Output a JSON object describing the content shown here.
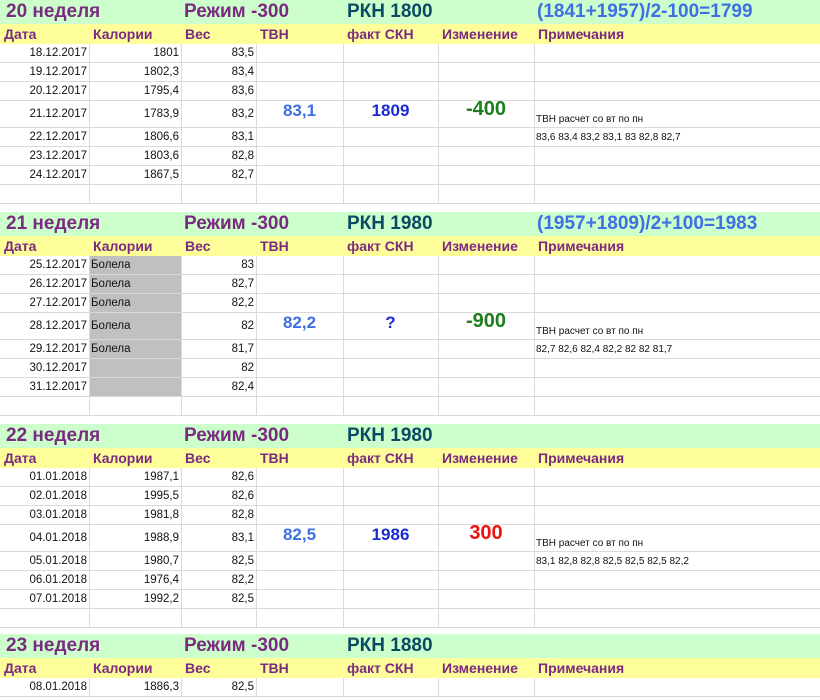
{
  "headers": {
    "date": "Дата",
    "calories": "Калории",
    "weight": "Вес",
    "tvn": "ТВН",
    "fact_skn": "факт СКН",
    "change": "Изменение",
    "notes": "Примечания"
  },
  "weeks": [
    {
      "week": "20  неделя",
      "mode": "Режим -300",
      "rkn": "РКН 1800",
      "formula": "(1841+1957)/2-100=1799",
      "rows": [
        {
          "date": "18.12.2017",
          "cal": "1801",
          "weight": "83,5"
        },
        {
          "date": "19.12.2017",
          "cal": "1802,3",
          "weight": "83,4"
        },
        {
          "date": "20.12.2017",
          "cal": "1795,4",
          "weight": "83,6"
        },
        {
          "date": "21.12.2017",
          "cal": "1783,9",
          "weight": "83,2",
          "tvn": "83,1",
          "fact": "1809",
          "change": "-400",
          "change_color": "green",
          "note": "ТВН расчет со вт по пн"
        },
        {
          "date": "22.12.2017",
          "cal": "1806,6",
          "weight": "83,1",
          "note": "83,6  83,4  83,2  83,1  83  82,8  82,7"
        },
        {
          "date": "23.12.2017",
          "cal": "1803,6",
          "weight": "82,8"
        },
        {
          "date": "24.12.2017",
          "cal": "1867,5",
          "weight": "82,7"
        }
      ]
    },
    {
      "week": "21  неделя",
      "mode": "Режим -300",
      "rkn": "РКН  1980",
      "formula": "(1957+1809)/2+100=1983",
      "rows": [
        {
          "date": "25.12.2017",
          "cal": "Болела",
          "weight": "83",
          "gray": true
        },
        {
          "date": "26.12.2017",
          "cal": "Болела",
          "weight": "82,7",
          "gray": true
        },
        {
          "date": "27.12.2017",
          "cal": "Болела",
          "weight": "82,2",
          "gray": true
        },
        {
          "date": "28.12.2017",
          "cal": "Болела",
          "weight": "82",
          "gray": true,
          "tvn": "82,2",
          "fact": "?",
          "change": "-900",
          "change_color": "green",
          "note": "ТВН расчет со вт по пн"
        },
        {
          "date": "29.12.2017",
          "cal": "Болела",
          "weight": "81,7",
          "gray": true,
          "note": "82,7  82,6  82,4  82,2  82  82  81,7"
        },
        {
          "date": "30.12.2017",
          "cal": "",
          "weight": "82",
          "gray": true
        },
        {
          "date": "31.12.2017",
          "cal": "",
          "weight": "82,4",
          "gray": true
        }
      ]
    },
    {
      "week": "22  неделя",
      "mode": "Режим -300",
      "rkn": "РКН  1980",
      "formula": "",
      "rows": [
        {
          "date": "01.01.2018",
          "cal": "1987,1",
          "weight": "82,6"
        },
        {
          "date": "02.01.2018",
          "cal": "1995,5",
          "weight": "82,6"
        },
        {
          "date": "03.01.2018",
          "cal": "1981,8",
          "weight": "82,8"
        },
        {
          "date": "04.01.2018",
          "cal": "1988,9",
          "weight": "83,1",
          "tvn": "82,5",
          "fact": "1986",
          "change": "300",
          "change_color": "red",
          "note": "ТВН расчет со вт по пн"
        },
        {
          "date": "05.01.2018",
          "cal": "1980,7",
          "weight": "82,5",
          "note": "83,1  82,8  82,8  82,5  82,5  82,5  82,2"
        },
        {
          "date": "06.01.2018",
          "cal": "1976,4",
          "weight": "82,2"
        },
        {
          "date": "07.01.2018",
          "cal": "1992,2",
          "weight": "82,5"
        }
      ]
    },
    {
      "week": "23  неделя",
      "mode": "Режим -300",
      "rkn": "РКН 1880",
      "formula": "",
      "rows": [
        {
          "date": "08.01.2018",
          "cal": "1886,3",
          "weight": "82,5"
        }
      ]
    }
  ],
  "colors": {
    "week_bg": "#ccffcc",
    "header_bg": "#fdfd99",
    "purple": "#7b2a82",
    "teal": "#0b4a63",
    "blue": "#3d6fe5",
    "green": "#1e7d1e",
    "red": "#ee1111",
    "gray_fill": "#c0c0c0"
  }
}
